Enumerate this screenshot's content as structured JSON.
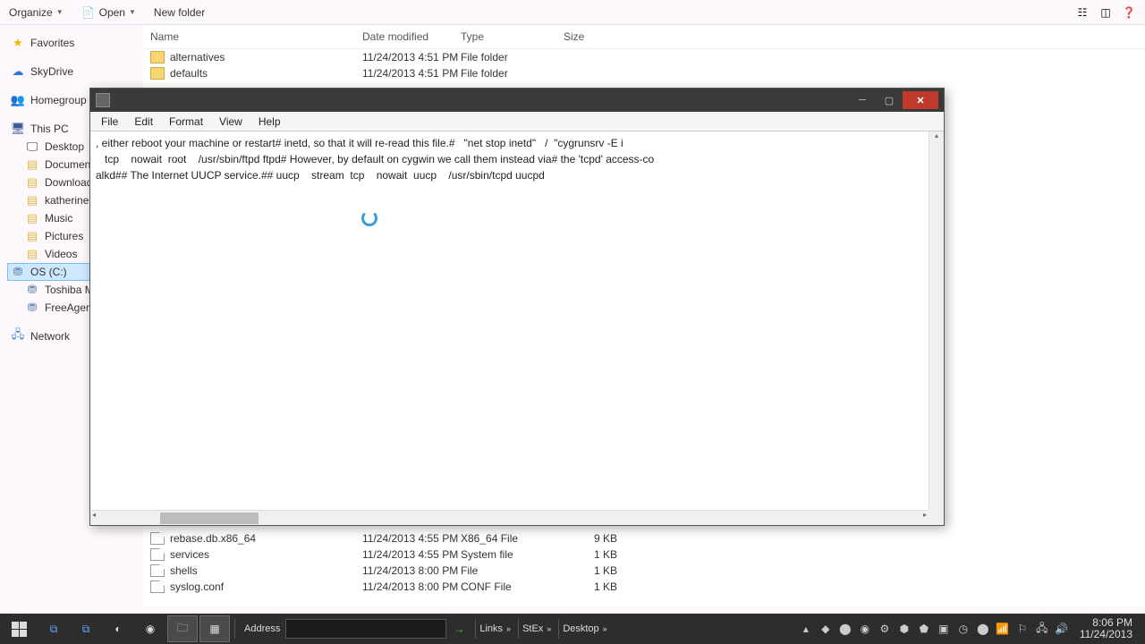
{
  "toolbar": {
    "organize": "Organize",
    "open": "Open",
    "newfolder": "New folder"
  },
  "sidebar": {
    "favorites": "Favorites",
    "skydrive": "SkyDrive",
    "homegroup": "Homegroup",
    "thispc": "This PC",
    "desktop": "Desktop",
    "documents": "Documents",
    "downloads": "Downloads",
    "katherine": "katherine",
    "music": "Music",
    "pictures": "Pictures",
    "videos": "Videos",
    "osc": "OS (C:)",
    "toshiba": "Toshiba M",
    "freeagent": "FreeAgent",
    "network": "Network"
  },
  "columns": {
    "name": "Name",
    "date": "Date modified",
    "type": "Type",
    "size": "Size"
  },
  "files_top": [
    {
      "name": "alternatives",
      "date": "11/24/2013 4:51 PM",
      "type": "File folder",
      "size": "",
      "icon": "folder"
    },
    {
      "name": "defaults",
      "date": "11/24/2013 4:51 PM",
      "type": "File folder",
      "size": "",
      "icon": "folder"
    }
  ],
  "files_bottom": [
    {
      "name": "rebase.db.x86_64",
      "date": "11/24/2013 4:55 PM",
      "type": "X86_64 File",
      "size": "9 KB",
      "icon": "file"
    },
    {
      "name": "services",
      "date": "11/24/2013 4:55 PM",
      "type": "System file",
      "size": "1 KB",
      "icon": "file"
    },
    {
      "name": "shells",
      "date": "11/24/2013 8:00 PM",
      "type": "File",
      "size": "1 KB",
      "icon": "file"
    },
    {
      "name": "syslog.conf",
      "date": "11/24/2013 8:00 PM",
      "type": "CONF File",
      "size": "1 KB",
      "icon": "file"
    }
  ],
  "notepad": {
    "menu": {
      "file": "File",
      "edit": "Edit",
      "format": "Format",
      "view": "View",
      "help": "Help"
    },
    "line1": ", either reboot your machine or restart# inetd, so that it will re-read this file.#   \"net stop inetd\"   /  \"cygrunsrv -E i",
    "line2": "   tcp    nowait  root    /usr/sbin/ftpd ftpd# However, by default on cygwin we call them instead via# the 'tcpd' access-co",
    "line3": "alkd## The Internet UUCP service.## uucp    stream  tcp    nowait  uucp    /usr/sbin/tcpd uucpd"
  },
  "taskbar": {
    "address_label": "Address",
    "links": "Links",
    "stex": "StEx",
    "desktop": "Desktop",
    "time": "8:06 PM",
    "date": "11/24/2013"
  }
}
